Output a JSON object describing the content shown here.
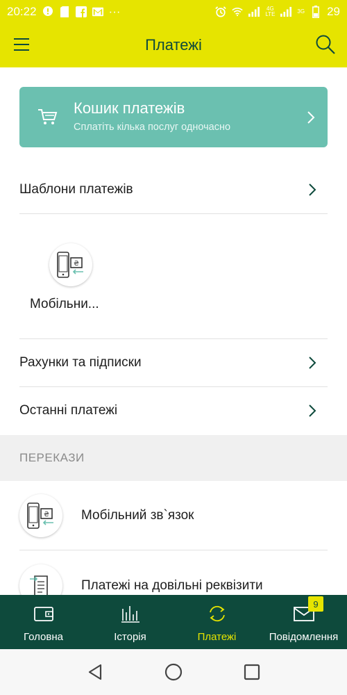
{
  "status_bar": {
    "time": "20:22",
    "battery": "29",
    "net_4g": "4G",
    "net_lte": "LTE",
    "net_3g": "3G",
    "more": "···"
  },
  "app_bar": {
    "title": "Платежі"
  },
  "cart": {
    "title": "Кошик платежів",
    "subtitle": "Сплатіть кілька послуг одночасно"
  },
  "rows": {
    "templates": "Шаблони платежів",
    "accounts": "Рахунки та підписки",
    "recent": "Останні платежі"
  },
  "tile": {
    "label": "Мобільни..."
  },
  "section": {
    "transfers": "ПЕРЕКАЗИ"
  },
  "list": {
    "mobile": "Мобільний зв`язок",
    "details": "Платежі на довільні реквізити"
  },
  "nav": {
    "home": "Головна",
    "history": "Історія",
    "payments": "Платежі",
    "messages": "Повідомлення",
    "badge": "9"
  },
  "colors": {
    "accent_yellow": "#e6e400",
    "dark_green": "#0e4a3c",
    "teal_card": "#6bc0b0"
  }
}
